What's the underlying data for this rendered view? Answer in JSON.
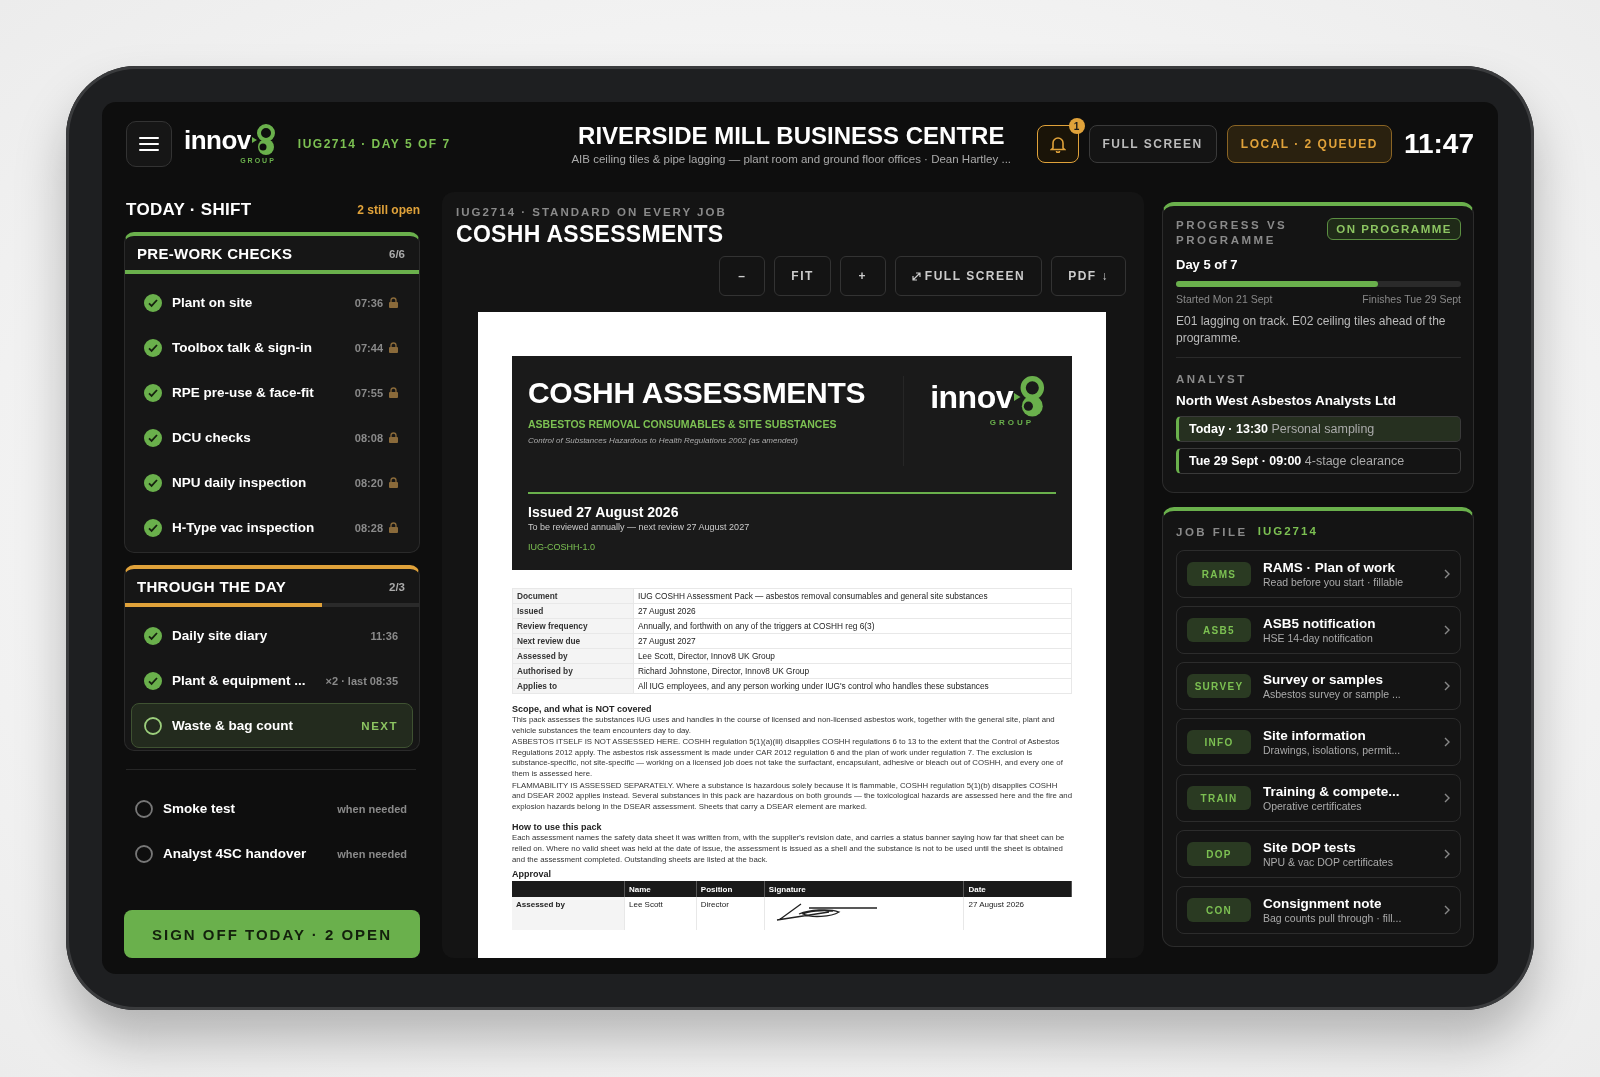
{
  "header": {
    "logo": {
      "word": "innov",
      "sub": "GROUP"
    },
    "job_ref": "IUG2714 · DAY 5 OF 7",
    "site_title": "RIVERSIDE MILL BUSINESS CENTRE",
    "site_subtitle": "AIB ceiling tiles & pipe lagging — plant room and ground floor offices · Dean Hartley ...",
    "notifications": {
      "count": "1"
    },
    "full_screen_button": "FULL SCREEN",
    "sync_status": "LOCAL · 2 QUEUED",
    "clock": "11:47"
  },
  "shift": {
    "title": "TODAY · SHIFT",
    "open_count": "2 still open",
    "groups": [
      {
        "title": "PRE-WORK CHECKS",
        "count": "6/6",
        "color": "#6ab04c",
        "level": 1,
        "items": [
          {
            "label": "Plant on site",
            "meta": "07:36",
            "done": true,
            "locked": true,
            "next": false
          },
          {
            "label": "Toolbox talk & sign-in",
            "meta": "07:44",
            "done": true,
            "locked": true,
            "next": false
          },
          {
            "label": "RPE pre-use & face-fit",
            "meta": "07:55",
            "done": true,
            "locked": true,
            "next": false
          },
          {
            "label": "DCU checks",
            "meta": "08:08",
            "done": true,
            "locked": true,
            "next": false
          },
          {
            "label": "NPU daily inspection",
            "meta": "08:20",
            "done": true,
            "locked": true,
            "next": false
          },
          {
            "label": "H-Type vac inspection",
            "meta": "08:28",
            "done": true,
            "locked": true,
            "next": false
          }
        ]
      },
      {
        "title": "THROUGH THE DAY",
        "count": "2/3",
        "color": "#e0a23a",
        "level": 0.67,
        "items": [
          {
            "label": "Daily site diary",
            "meta": "11:36",
            "done": true,
            "locked": false,
            "next": false
          },
          {
            "label": "Plant & equipment ...",
            "meta": "×2 · last 08:35",
            "done": true,
            "locked": false,
            "next": false
          },
          {
            "label": "Waste & bag count",
            "meta": "NEXT",
            "done": false,
            "locked": false,
            "next": true
          }
        ]
      }
    ],
    "optional": [
      {
        "label": "Smoke test",
        "meta": "when needed",
        "done": false
      },
      {
        "label": "Analyst 4SC handover",
        "meta": "when needed",
        "done": false
      }
    ],
    "sign_off_button": "SIGN OFF TODAY · 2 OPEN"
  },
  "viewer": {
    "eyebrow": "IUG2714 · STANDARD ON EVERY JOB",
    "title": "COSHH ASSESSMENTS",
    "tools": [
      {
        "label": "–",
        "kind": "plain"
      },
      {
        "label": "FIT",
        "kind": "plain"
      },
      {
        "label": "+",
        "kind": "plain"
      },
      {
        "label": "FULL SCREEN",
        "kind": "expand"
      },
      {
        "label": "PDF ↓",
        "kind": "plain"
      }
    ],
    "document": {
      "title": "COSHH ASSESSMENTS",
      "subtitle": "ASBESTOS REMOVAL CONSUMABLES & SITE SUBSTANCES",
      "regulation": "Control of Substances Hazardous to Health Regulations 2002 (as amended)",
      "logo": {
        "word": "innov",
        "sub": "GROUP"
      },
      "issued": "Issued 27 August 2026",
      "review_note": "To be reviewed annually — next review 27 August 2027",
      "code": "IUG-COSHH-1.0",
      "info_rows": [
        {
          "label": "Document",
          "value": "IUG COSHH Assessment Pack — asbestos removal consumables and general site substances"
        },
        {
          "label": "Issued",
          "value": "27 August 2026"
        },
        {
          "label": "Review frequency",
          "value": "Annually, and forthwith on any of the triggers at COSHH reg 6(3)"
        },
        {
          "label": "Next review due",
          "value": "27 August 2027"
        },
        {
          "label": "Assessed by",
          "value": "Lee Scott, Director, Innov8 UK Group"
        },
        {
          "label": "Authorised by",
          "value": "Richard Johnstone, Director, Innov8 UK Group"
        },
        {
          "label": "Applies to",
          "value": "All IUG employees, and any person working under IUG's control who handles these substances"
        }
      ],
      "sections": [
        {
          "heading": "Scope, and what is NOT covered",
          "paragraphs": [
            "This pack assesses the substances IUG uses and handles in the course of licensed and non-licensed asbestos work, together with the general site, plant and vehicle substances the team encounters day to day.",
            "ASBESTOS ITSELF IS NOT ASSESSED HERE. COSHH regulation 5(1)(a)(iii) disapplies COSHH regulations 6 to 13 to the extent that the Control of Asbestos Regulations 2012 apply. The asbestos risk assessment is made under CAR 2012 regulation 6 and the plan of work under regulation 7. The exclusion is substance-specific, not site-specific — working on a licensed job does not take the surfactant, encapsulant, adhesive or bleach out of COSHH, and every one of them is assessed here.",
            "FLAMMABILITY IS ASSESSED SEPARATELY. Where a substance is hazardous solely because it is flammable, COSHH regulation 5(1)(b) disapplies COSHH and DSEAR 2002 applies instead. Several substances in this pack are hazardous on both grounds — the toxicological hazards are assessed here and the fire and explosion hazards belong in the DSEAR assessment. Sheets that carry a DSEAR element are marked."
          ]
        },
        {
          "heading": "How to use this pack",
          "paragraphs": [
            "Each assessment names the safety data sheet it was written from, with the supplier's revision date, and carries a status banner saying how far that sheet can be relied on. Where no valid sheet was held at the date of issue, the assessment is issued as a shell and the substance is not to be used until the sheet is obtained and the assessment completed. Outstanding sheets are listed at the back."
          ]
        }
      ],
      "approval": {
        "heading": "Approval",
        "columns": [
          "Name",
          "Position",
          "Signature",
          "Date"
        ],
        "rows": [
          {
            "role": "Assessed by",
            "name": "Lee Scott",
            "position": "Director",
            "date": "27 August 2026"
          }
        ]
      }
    }
  },
  "progress": {
    "title": "PROGRESS VS PROGRAMME",
    "status": "ON PROGRAMME",
    "day": "Day 5 of 7",
    "level": 0.71,
    "start": "Started Mon 21 Sept",
    "finish": "Finishes Tue 29 Sept",
    "note": "E01 lagging on track. E02 ceiling tiles ahead of the programme.",
    "analyst": {
      "title": "ANALYST",
      "company": "North West Asbestos Analysts Ltd",
      "visits": [
        {
          "when": "Today · 13:30",
          "what": "Personal sampling",
          "selected": true
        },
        {
          "when": "Tue 29 Sept · 09:00",
          "what": "4-stage clearance",
          "selected": false
        }
      ]
    }
  },
  "job_file": {
    "title": "JOB FILE",
    "ref": "IUG2714",
    "items": [
      {
        "tag": "RAMS",
        "title": "RAMS · Plan of work",
        "subtitle": "Read before you start · fillable"
      },
      {
        "tag": "ASB5",
        "title": "ASB5 notification",
        "subtitle": "HSE 14-day notification"
      },
      {
        "tag": "SURVEY",
        "title": "Survey or samples",
        "subtitle": "Asbestos survey or sample ..."
      },
      {
        "tag": "INFO",
        "title": "Site information",
        "subtitle": "Drawings, isolations, permit..."
      },
      {
        "tag": "TRAIN",
        "title": "Training & compete...",
        "subtitle": "Operative certificates"
      },
      {
        "tag": "DOP",
        "title": "Site DOP tests",
        "subtitle": "NPU & vac DOP certificates"
      },
      {
        "tag": "CON",
        "title": "Consignment note",
        "subtitle": "Bag counts pull through · fill..."
      }
    ]
  }
}
